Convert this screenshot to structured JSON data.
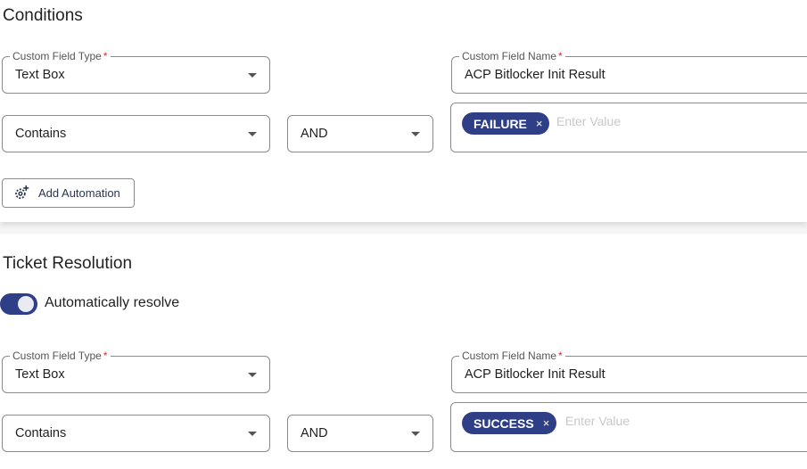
{
  "conditions": {
    "title": "Conditions",
    "field_type": {
      "legend": "Custom Field Type",
      "required_mark": "*",
      "value": "Text Box"
    },
    "field_name": {
      "legend": "Custom Field Name",
      "required_mark": "*",
      "value": "ACP Bitlocker Init Result"
    },
    "operator": {
      "value": "Contains"
    },
    "logic": {
      "value": "AND"
    },
    "values": {
      "chip_label": "FAILURE",
      "chip_remove": "×",
      "placeholder": "Enter Value"
    },
    "add_automation_label": "Add Automation"
  },
  "ticket_resolution": {
    "title": "Ticket Resolution",
    "toggle": {
      "label": "Automatically resolve",
      "on": true
    },
    "field_type": {
      "legend": "Custom Field Type",
      "required_mark": "*",
      "value": "Text Box"
    },
    "field_name": {
      "legend": "Custom Field Name",
      "required_mark": "*",
      "value": "ACP Bitlocker Init Result"
    },
    "operator": {
      "value": "Contains"
    },
    "logic": {
      "value": "AND"
    },
    "values": {
      "chip_label": "SUCCESS",
      "chip_remove": "×",
      "placeholder": "Enter Value"
    }
  },
  "colors": {
    "accent": "#2f3f87",
    "required": "#d32f2f",
    "border": "#8a8a8a"
  }
}
